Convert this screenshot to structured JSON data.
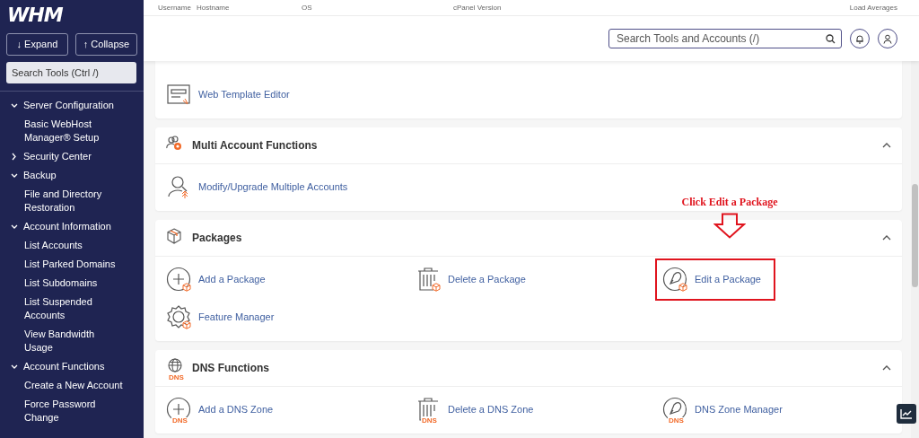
{
  "sidebar": {
    "logo": "WHM",
    "buttons": [
      {
        "glyph": "↓",
        "label": "Expand"
      },
      {
        "glyph": "↑",
        "label": "Collapse"
      }
    ],
    "search": {
      "placeholder": "Search Tools (Ctrl /)"
    },
    "tree": [
      {
        "label": "Server Configuration",
        "expanded": true,
        "children": [
          {
            "label": "Basic WebHost Manager® Setup"
          }
        ]
      },
      {
        "label": "Security Center",
        "expanded": false
      },
      {
        "label": "Backup",
        "expanded": true,
        "children": [
          {
            "label": "File and Directory Restoration"
          }
        ]
      },
      {
        "label": "Account Information",
        "expanded": true,
        "children": [
          {
            "label": "List Accounts"
          },
          {
            "label": "List Parked Domains"
          },
          {
            "label": "List Subdomains"
          },
          {
            "label": "List Suspended Accounts"
          },
          {
            "label": "View Bandwidth Usage"
          }
        ]
      },
      {
        "label": "Account Functions",
        "expanded": true,
        "children": [
          {
            "label": "Create a New Account"
          },
          {
            "label": "Force Password Change"
          }
        ]
      }
    ]
  },
  "stats": [
    "Username",
    "Hostname",
    "OS",
    "cPanel Version",
    "Load Averages"
  ],
  "header": {
    "search": {
      "placeholder": "Search Tools and Accounts (/)"
    }
  },
  "sections": [
    {
      "items": [
        {
          "kind": "template",
          "label": "Web Template Editor"
        }
      ]
    },
    {
      "title": "Multi Account Functions",
      "kind": "accounts",
      "expanded": true,
      "items": [
        {
          "kind": "account-upgrade",
          "label": "Modify/Upgrade Multiple Accounts"
        }
      ]
    },
    {
      "title": "Packages",
      "kind": "packages",
      "expanded": true,
      "items": [
        {
          "kind": "add",
          "package_badge": true,
          "label": "Add a Package"
        },
        {
          "kind": "delete",
          "package_badge": true,
          "label": "Delete a Package"
        },
        {
          "kind": "edit",
          "package_badge": true,
          "label": "Edit a Package",
          "highlighted": true,
          "callout": "Click Edit a Package"
        },
        {
          "kind": "feature",
          "package_badge": true,
          "label": "Feature Manager"
        }
      ]
    },
    {
      "title": "DNS Functions",
      "kind": "dns",
      "icon_text": "DNS",
      "expanded": true,
      "items": [
        {
          "kind": "add",
          "badge_text": "DNS",
          "label": "Add a DNS Zone"
        },
        {
          "kind": "delete",
          "badge_text": "DNS",
          "label": "Delete a DNS Zone"
        },
        {
          "kind": "edit",
          "badge_text": "DNS",
          "label": "DNS Zone Manager"
        }
      ]
    }
  ]
}
